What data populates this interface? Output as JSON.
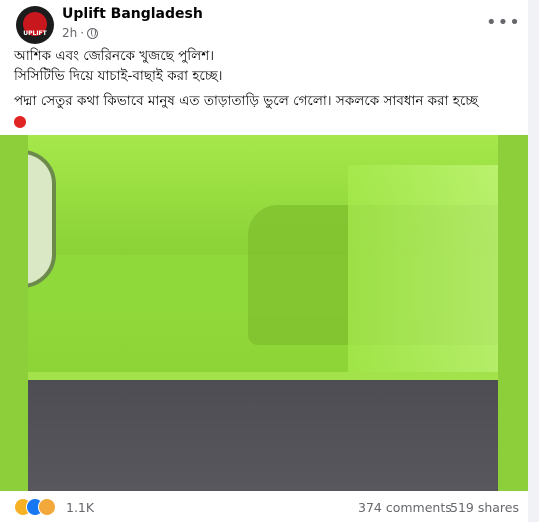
{
  "post": {
    "page_name": "Uplift Bangladesh",
    "time": "2h",
    "avatar_text": "UPLIFT",
    "more_label": "•••",
    "lines": [
      "আশিক এবং জেরিনকে খুজছে পুলিশ।",
      "সিসিটিভি দিয়ে যাচাই-বাছাই করা হচ্ছে।",
      "পদ্মা সেতুর কথা কিভাবে মানুষ এত তাড়াতাড়ি ভুলে গেলো। সকলকে সাবধান করা হচ্ছে"
    ]
  },
  "stats": {
    "reactions": "1.1K",
    "comments": "374 comments",
    "shares": "519 shares"
  },
  "icons": {
    "privacy": "globe-icon",
    "reactions": [
      "haha-icon",
      "like-icon",
      "sad-icon"
    ]
  },
  "colors": {
    "photo_border": "#8ccf3a",
    "secondary_text": "#65676b"
  }
}
